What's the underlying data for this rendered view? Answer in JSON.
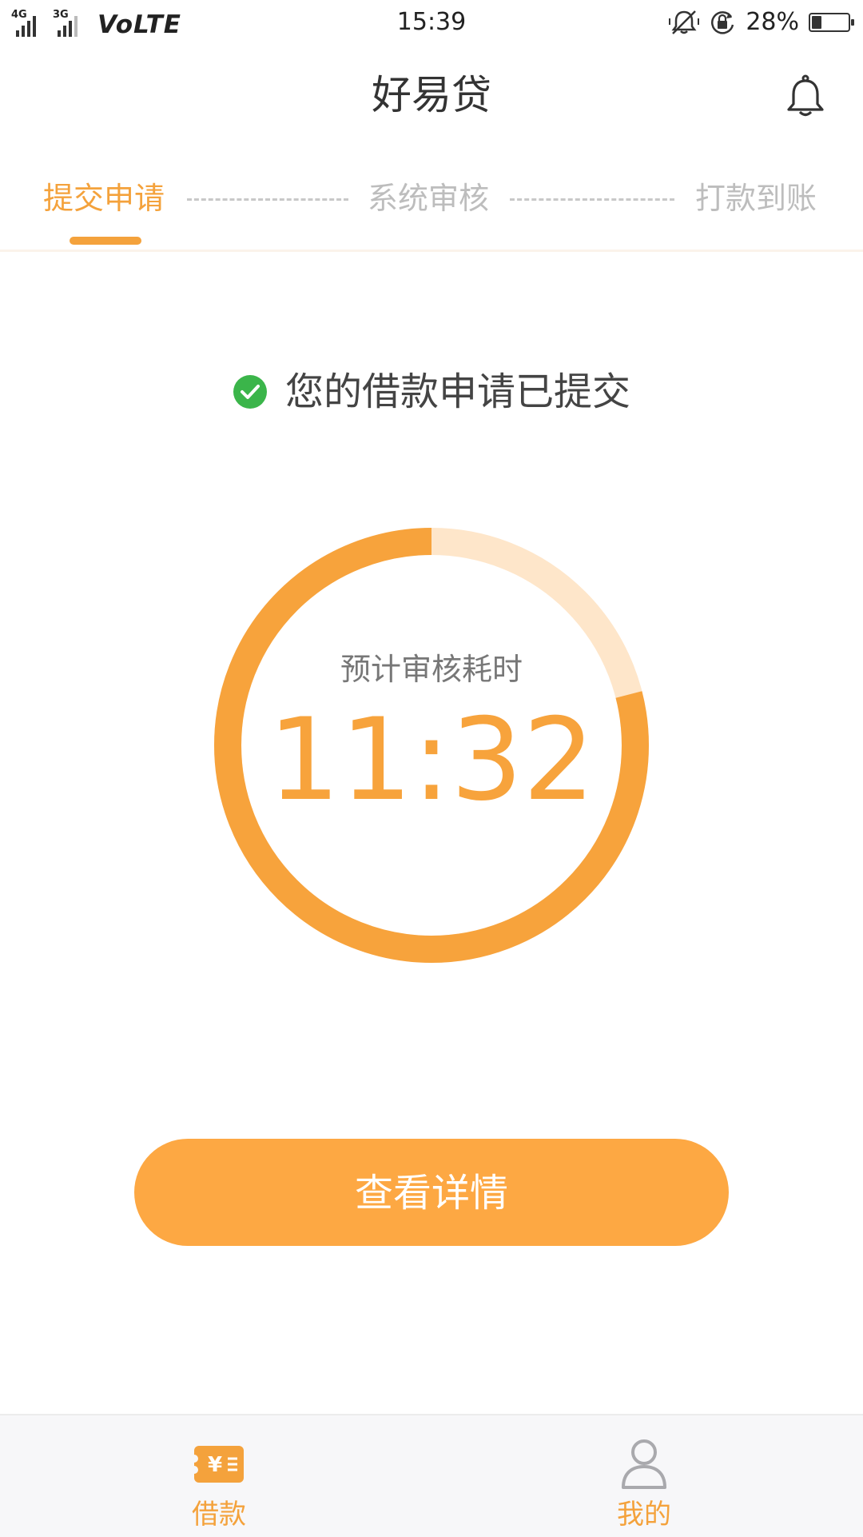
{
  "status_bar": {
    "network_1": "4G",
    "network_2": "3G",
    "volte": "VoLTE",
    "time": "15:39",
    "battery_percent": "28%",
    "battery_level": 0.28,
    "icons": [
      "silent-icon",
      "rotation-lock-icon",
      "battery-icon"
    ]
  },
  "header": {
    "title": "好易贷",
    "icon": "bell-icon"
  },
  "steps": [
    {
      "label": "提交申请",
      "active": true
    },
    {
      "label": "系统审核",
      "active": false
    },
    {
      "label": "打款到账",
      "active": false
    }
  ],
  "notice": {
    "text": "您的借款申请已提交",
    "icon": "check-circle-icon",
    "icon_color": "#3bb54a"
  },
  "timer": {
    "label": "预计审核耗时",
    "value": "11:32",
    "progress": 0.79,
    "color": "#f7a33c",
    "track_color": "#fee6ca"
  },
  "primary_button": {
    "label": "查看详情",
    "color": "#fda843"
  },
  "bottom_nav": [
    {
      "label": "借款",
      "icon": "loan-icon",
      "active": true
    },
    {
      "label": "我的",
      "icon": "user-icon",
      "active": false
    }
  ],
  "colors": {
    "accent": "#f4a23c",
    "inactive": "#bdbdbd"
  }
}
